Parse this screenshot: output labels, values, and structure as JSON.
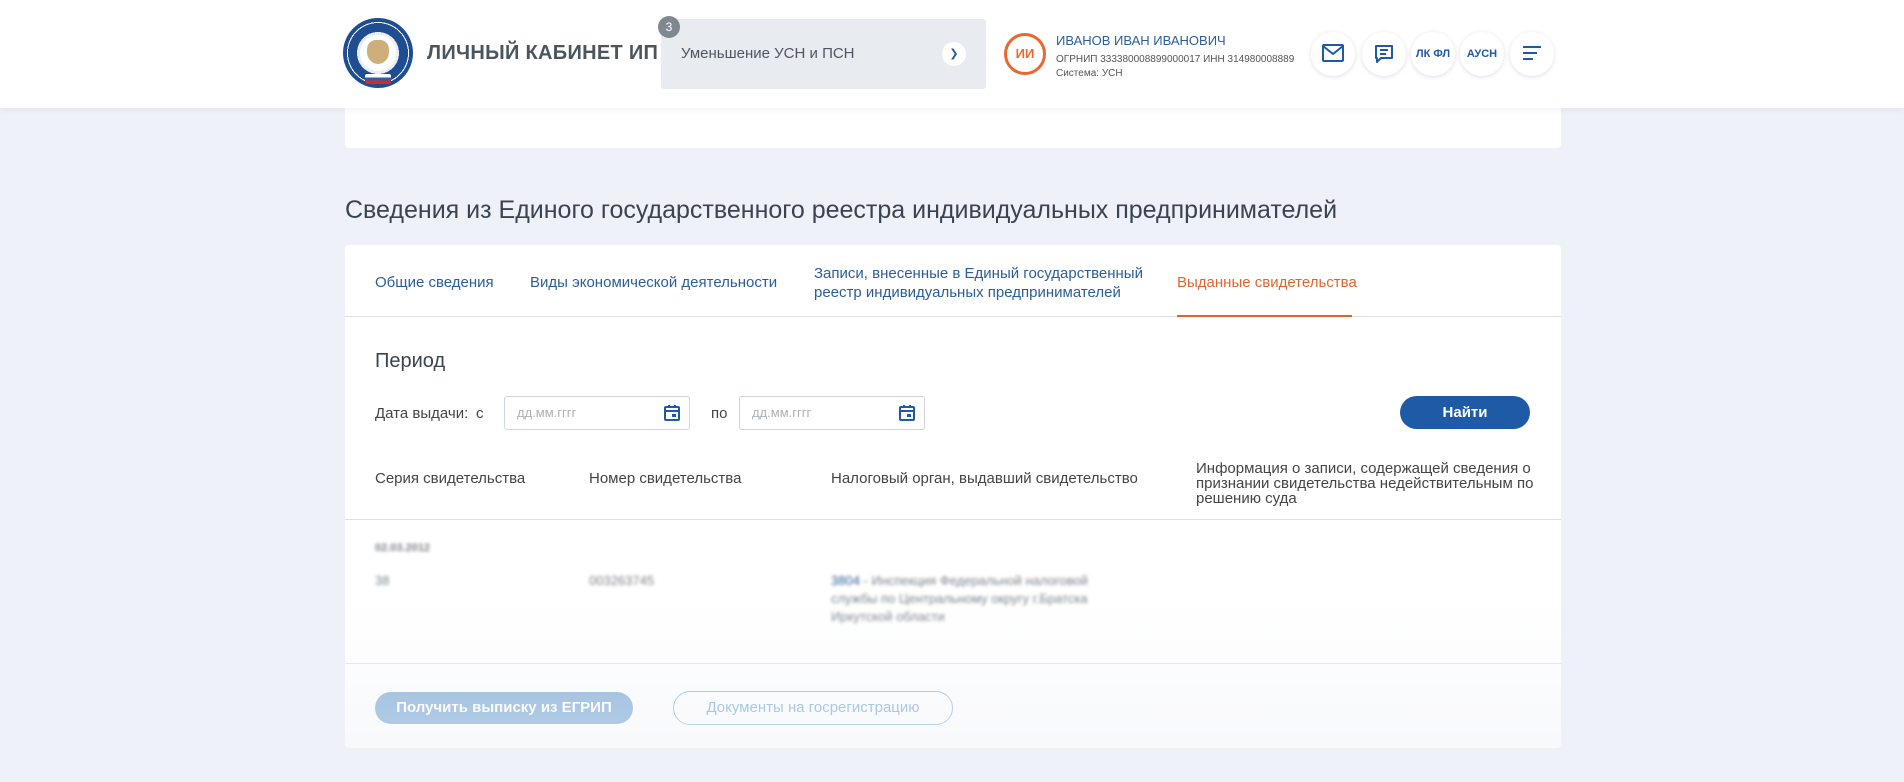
{
  "header": {
    "cabinet_title": "ЛИЧНЫЙ КАБИНЕТ ИП",
    "select": {
      "badge": "3",
      "value": "Уменьшение УСН и ПСН"
    },
    "user": {
      "initials": "ИИ",
      "name": "ИВАНОВ ИВАН ИВАНОВИЧ",
      "meta": "ОГРНИП 333380008899000017   ИНН 314980008889",
      "system": "Система: УСН"
    },
    "buttons": {
      "mail_icon": "mail-icon",
      "chat_icon": "chat-icon",
      "lk_fl": "ЛК ФЛ",
      "ausn": "АУСН",
      "menu_icon": "menu-icon"
    }
  },
  "section_title": "Сведения из Единого государственного реестра индивидуальных предпринимателей",
  "tabs": [
    {
      "label": "Общие сведения"
    },
    {
      "label": "Виды экономической деятельности"
    },
    {
      "label_line1": "Записи, внесенные в Единый государственный",
      "label_line2": "реестр индивидуальных предпринимателей"
    },
    {
      "label": "Выданные свидетельства",
      "active": true
    }
  ],
  "filter": {
    "period_title": "Период",
    "date_label": "Дата выдачи:",
    "from_label": "с",
    "to_label": "по",
    "from_placeholder": "дд.мм.гггг",
    "to_placeholder": "дд.мм.гггг",
    "find_button": "Найти"
  },
  "table": {
    "columns": [
      "Серия свидетельства",
      "Номер свидетельства",
      "Налоговый орган, выдавший свидетельство",
      "Информация о записи, содержащей сведения о признании свидетельства недействительным по решению суда"
    ],
    "rows": [
      {
        "date": "02.03.2012",
        "series": "38",
        "number": "003263745",
        "authority_code": "3804",
        "authority_line1": " - Инспекция Федеральной налоговой",
        "authority_line2": "службы по Центральному округу г.Братска",
        "authority_line3": "Иркутской области",
        "info": ""
      }
    ]
  },
  "footer": {
    "egrip_button": "Получить выписку из ЕГРИП",
    "docs_button": "Документы на госрегистрацию"
  },
  "colors": {
    "primary": "#1f5aa6",
    "accent": "#e0652c",
    "background": "#eef1f7"
  }
}
